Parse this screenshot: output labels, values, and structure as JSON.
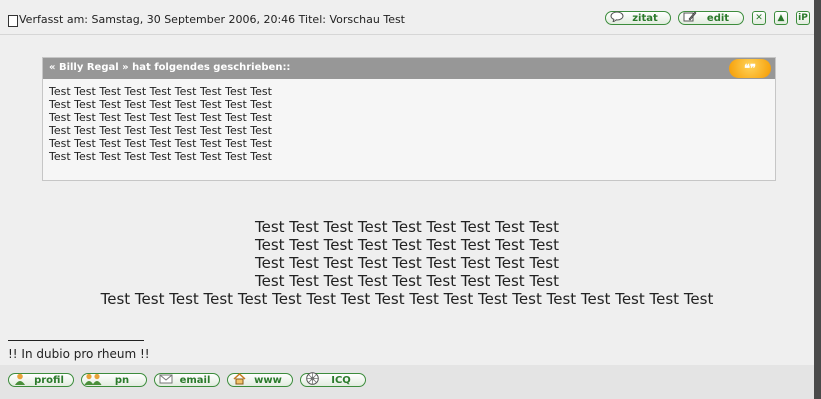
{
  "post_header": {
    "label": "Verfasst am: Samstag, 30 September 2006, 20:46    Titel: Vorschau Test",
    "buttons": {
      "quote": {
        "label": "zitat",
        "icon": "quote-bubble-icon"
      },
      "edit": {
        "label": "edit",
        "icon": "edit-pencil-icon"
      },
      "delete": {
        "icon": "delete-x-icon",
        "symbol": "✕"
      },
      "up": {
        "icon": "arrow-up-icon",
        "symbol": "▲"
      },
      "ip": {
        "label": "iP",
        "icon": "ip-icon"
      }
    }
  },
  "quote_block": {
    "author_line": "« Billy Regal » hat folgendes geschrieben::",
    "badge": "❝❞",
    "lines": [
      "Test Test Test Test Test Test Test Test Test",
      "Test Test Test Test Test Test Test Test Test",
      "Test Test Test Test Test Test Test Test Test",
      "Test Test Test Test Test Test Test Test Test",
      "Test Test Test Test Test Test Test Test Test",
      "Test Test Test Test Test Test Test Test Test"
    ]
  },
  "post_body": {
    "lines": [
      "Test Test Test Test Test Test Test Test Test",
      "Test Test Test Test Test Test Test Test Test",
      "Test Test Test Test Test Test Test Test Test",
      "Test Test Test Test Test Test Test Test Test",
      "Test Test Test Test Test Test Test Test Test Test Test Test Test Test Test Test Test Test"
    ]
  },
  "signature": "!! In dubio pro rheum !!",
  "footer": {
    "buttons": [
      {
        "label": "profil",
        "icon": "user-profile-icon"
      },
      {
        "label": "pn",
        "icon": "private-message-icon"
      },
      {
        "label": "email",
        "icon": "email-icon"
      },
      {
        "label": "www",
        "icon": "home-www-icon"
      },
      {
        "label": "ICQ",
        "icon": "icq-flower-icon"
      }
    ]
  },
  "colors": {
    "accent_green": "#2c7a2c",
    "quote_header": "#979797",
    "quote_badge": "#f59a00"
  }
}
